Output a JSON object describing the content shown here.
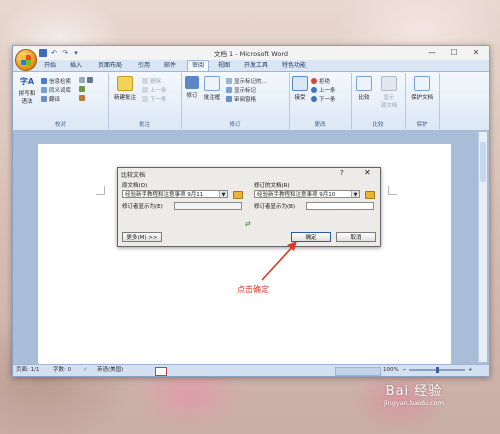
{
  "window": {
    "title": "文档 1 - Microsoft Word",
    "controls": [
      "—",
      "☐",
      "✕"
    ]
  },
  "tabs": [
    "开始",
    "插入",
    "页面布局",
    "引用",
    "邮件",
    "审阅",
    "视图",
    "开发工具",
    "特色功能"
  ],
  "active_tab": "审阅",
  "ribbon": {
    "proofing": {
      "label": "校对",
      "spell_line1": "拼写和",
      "spell_line2": "语法",
      "spell_glyph": "字A",
      "research": "信息检索",
      "thesaurus": "同义词库",
      "translate": "翻译"
    },
    "comments": {
      "label": "批注",
      "new_comment": "新建批注",
      "delete": "删除",
      "previous": "上一条",
      "next": "下一条"
    },
    "tracking": {
      "label": "修订",
      "track_changes": "修订",
      "balloons": "批注框",
      "show_markup": "显示标记的...",
      "show_markup2": "显示标记",
      "reviewing_pane": "审阅窗格"
    },
    "changes": {
      "label": "更改",
      "accept": "接受",
      "reject": "拒绝",
      "previous": "上一条",
      "next": "下一条"
    },
    "compare": {
      "label": "比较",
      "compare": "比较",
      "show_source_line1": "显示",
      "show_source_line2": "源文档"
    },
    "protect": {
      "label": "保护",
      "protect_document": "保护文档"
    }
  },
  "dialog": {
    "title": "比较文档",
    "help": "?",
    "close": "✕",
    "original_label": "原文档(O)",
    "original_value": "经验新手教程和注意事项 9月11",
    "revised_label": "修订的文档(R)",
    "revised_value": "经验新手教程和注意事项 9月10",
    "label_changes_left": "修订者显示为(E)",
    "label_changes_right": "修订者显示为(B)",
    "more_button": "更多(M) >>",
    "ok_button": "确定",
    "cancel_button": "取消",
    "swap_icon": "⇄"
  },
  "statusbar": {
    "page": "页面: 1/1",
    "words": "字数: 0",
    "language": "英语(美国)",
    "zoom": "100%",
    "zoom_minus": "−",
    "zoom_plus": "+"
  },
  "annotation": "点击确定",
  "watermark": {
    "main": "Bai 经验",
    "sub": "jingyan.baidu.com"
  },
  "colors": {
    "annotation": "#d63a2a",
    "ribbon_bg": "#dce8f6",
    "doc_bg": "#a9bdd8"
  }
}
